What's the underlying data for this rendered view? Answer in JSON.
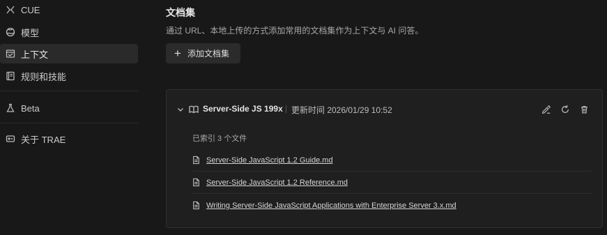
{
  "sidebar": {
    "items": [
      {
        "label": "CUE",
        "icon": "cue-icon"
      },
      {
        "label": "模型",
        "icon": "globe-icon"
      },
      {
        "label": "上下文",
        "icon": "context-icon",
        "active": true
      },
      {
        "label": "规则和技能",
        "icon": "book-icon"
      },
      {
        "label": "Beta",
        "icon": "flask-icon"
      },
      {
        "label": "关于 TRAE",
        "icon": "about-icon"
      }
    ]
  },
  "main": {
    "title": "文档集",
    "description": "通过 URL、本地上传的方式添加常用的文档集作为上下文与 AI 问答。",
    "add_button_label": "添加文档集"
  },
  "docset": {
    "name": "Server-Side JS 199x",
    "updated": "更新时间 2026/01/29 10:52",
    "indexed_count_label": "已索引 3 个文件",
    "files": [
      "Server-Side JavaScript 1.2 Guide.md",
      "Server-Side JavaScript 1.2 Reference.md",
      "Writing Server-Side JavaScript Applications with Enterprise Server 3.x.md"
    ],
    "actions": [
      "edit-icon",
      "refresh-icon",
      "trash-icon"
    ]
  },
  "colors": {
    "background": "#181818",
    "active_item": "#2a2a2a",
    "card": "#1f1f1f"
  }
}
